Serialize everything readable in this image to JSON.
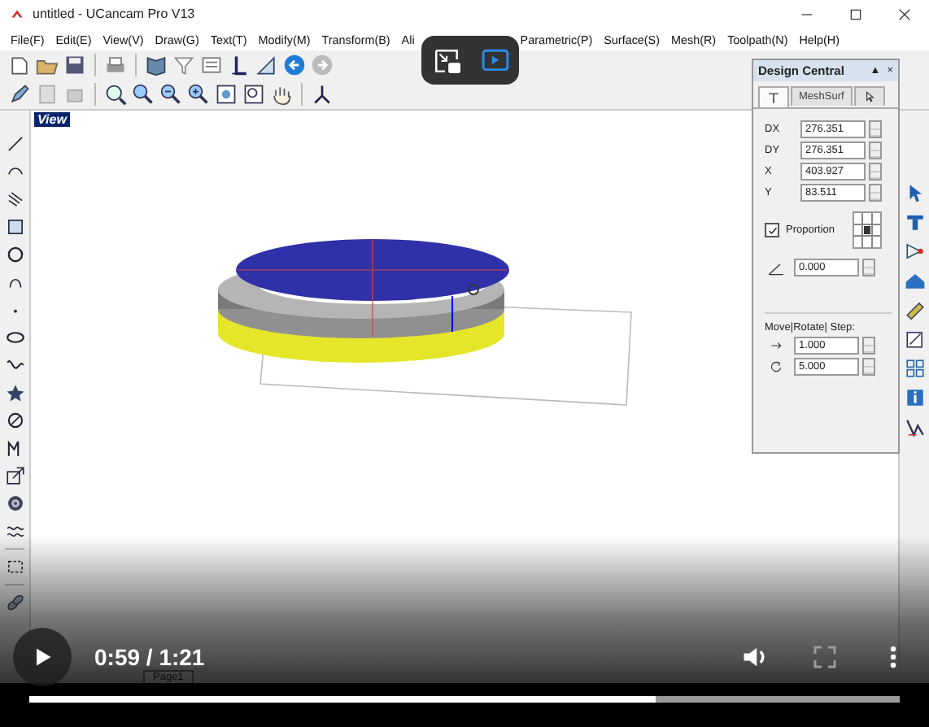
{
  "window": {
    "title": "untitled - UCancam Pro V13"
  },
  "menu": [
    "File(F)",
    "Edit(E)",
    "View(V)",
    "Draw(G)",
    "Text(T)",
    "Modify(M)",
    "Transform(B)",
    "Ali",
    "Parametric(P)",
    "Surface(S)",
    "Mesh(R)",
    "Toolpath(N)",
    "Help(H)"
  ],
  "view_label": "View",
  "design_central": {
    "title": "Design Central",
    "buttons": [
      "▲",
      "×"
    ],
    "tabs": [
      {
        "kind": "text-tool",
        "selected": true
      },
      {
        "kind": "label",
        "label": "MeshSurf",
        "selected": false
      },
      {
        "kind": "pointer",
        "selected": false
      }
    ],
    "fields": [
      {
        "label": "DX",
        "value": "276.351"
      },
      {
        "label": "DY",
        "value": "276.351"
      },
      {
        "label": "X",
        "value": "403.927"
      },
      {
        "label": "Y",
        "value": "83.511"
      }
    ],
    "proportion": {
      "label": "Proportion",
      "checked": true
    },
    "angle": {
      "value": "0.000"
    },
    "step": {
      "title": "Move|Rotate| Step:",
      "move": "1.000",
      "rotate": "5.000"
    }
  },
  "page_tab": "Page1",
  "player": {
    "playing": false,
    "time": "0:59 / 1:21",
    "progress": {
      "level": 0.72
    }
  }
}
